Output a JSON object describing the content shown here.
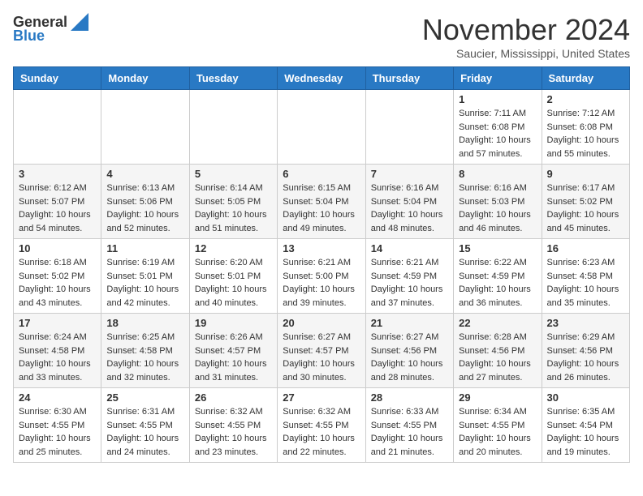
{
  "header": {
    "logo_general": "General",
    "logo_blue": "Blue",
    "month_title": "November 2024",
    "location": "Saucier, Mississippi, United States"
  },
  "weekdays": [
    "Sunday",
    "Monday",
    "Tuesday",
    "Wednesday",
    "Thursday",
    "Friday",
    "Saturday"
  ],
  "weeks": [
    [
      {
        "day": "",
        "info": ""
      },
      {
        "day": "",
        "info": ""
      },
      {
        "day": "",
        "info": ""
      },
      {
        "day": "",
        "info": ""
      },
      {
        "day": "",
        "info": ""
      },
      {
        "day": "1",
        "info": "Sunrise: 7:11 AM\nSunset: 6:08 PM\nDaylight: 10 hours and 57 minutes."
      },
      {
        "day": "2",
        "info": "Sunrise: 7:12 AM\nSunset: 6:08 PM\nDaylight: 10 hours and 55 minutes."
      }
    ],
    [
      {
        "day": "3",
        "info": "Sunrise: 6:12 AM\nSunset: 5:07 PM\nDaylight: 10 hours and 54 minutes."
      },
      {
        "day": "4",
        "info": "Sunrise: 6:13 AM\nSunset: 5:06 PM\nDaylight: 10 hours and 52 minutes."
      },
      {
        "day": "5",
        "info": "Sunrise: 6:14 AM\nSunset: 5:05 PM\nDaylight: 10 hours and 51 minutes."
      },
      {
        "day": "6",
        "info": "Sunrise: 6:15 AM\nSunset: 5:04 PM\nDaylight: 10 hours and 49 minutes."
      },
      {
        "day": "7",
        "info": "Sunrise: 6:16 AM\nSunset: 5:04 PM\nDaylight: 10 hours and 48 minutes."
      },
      {
        "day": "8",
        "info": "Sunrise: 6:16 AM\nSunset: 5:03 PM\nDaylight: 10 hours and 46 minutes."
      },
      {
        "day": "9",
        "info": "Sunrise: 6:17 AM\nSunset: 5:02 PM\nDaylight: 10 hours and 45 minutes."
      }
    ],
    [
      {
        "day": "10",
        "info": "Sunrise: 6:18 AM\nSunset: 5:02 PM\nDaylight: 10 hours and 43 minutes."
      },
      {
        "day": "11",
        "info": "Sunrise: 6:19 AM\nSunset: 5:01 PM\nDaylight: 10 hours and 42 minutes."
      },
      {
        "day": "12",
        "info": "Sunrise: 6:20 AM\nSunset: 5:01 PM\nDaylight: 10 hours and 40 minutes."
      },
      {
        "day": "13",
        "info": "Sunrise: 6:21 AM\nSunset: 5:00 PM\nDaylight: 10 hours and 39 minutes."
      },
      {
        "day": "14",
        "info": "Sunrise: 6:21 AM\nSunset: 4:59 PM\nDaylight: 10 hours and 37 minutes."
      },
      {
        "day": "15",
        "info": "Sunrise: 6:22 AM\nSunset: 4:59 PM\nDaylight: 10 hours and 36 minutes."
      },
      {
        "day": "16",
        "info": "Sunrise: 6:23 AM\nSunset: 4:58 PM\nDaylight: 10 hours and 35 minutes."
      }
    ],
    [
      {
        "day": "17",
        "info": "Sunrise: 6:24 AM\nSunset: 4:58 PM\nDaylight: 10 hours and 33 minutes."
      },
      {
        "day": "18",
        "info": "Sunrise: 6:25 AM\nSunset: 4:58 PM\nDaylight: 10 hours and 32 minutes."
      },
      {
        "day": "19",
        "info": "Sunrise: 6:26 AM\nSunset: 4:57 PM\nDaylight: 10 hours and 31 minutes."
      },
      {
        "day": "20",
        "info": "Sunrise: 6:27 AM\nSunset: 4:57 PM\nDaylight: 10 hours and 30 minutes."
      },
      {
        "day": "21",
        "info": "Sunrise: 6:27 AM\nSunset: 4:56 PM\nDaylight: 10 hours and 28 minutes."
      },
      {
        "day": "22",
        "info": "Sunrise: 6:28 AM\nSunset: 4:56 PM\nDaylight: 10 hours and 27 minutes."
      },
      {
        "day": "23",
        "info": "Sunrise: 6:29 AM\nSunset: 4:56 PM\nDaylight: 10 hours and 26 minutes."
      }
    ],
    [
      {
        "day": "24",
        "info": "Sunrise: 6:30 AM\nSunset: 4:55 PM\nDaylight: 10 hours and 25 minutes."
      },
      {
        "day": "25",
        "info": "Sunrise: 6:31 AM\nSunset: 4:55 PM\nDaylight: 10 hours and 24 minutes."
      },
      {
        "day": "26",
        "info": "Sunrise: 6:32 AM\nSunset: 4:55 PM\nDaylight: 10 hours and 23 minutes."
      },
      {
        "day": "27",
        "info": "Sunrise: 6:32 AM\nSunset: 4:55 PM\nDaylight: 10 hours and 22 minutes."
      },
      {
        "day": "28",
        "info": "Sunrise: 6:33 AM\nSunset: 4:55 PM\nDaylight: 10 hours and 21 minutes."
      },
      {
        "day": "29",
        "info": "Sunrise: 6:34 AM\nSunset: 4:55 PM\nDaylight: 10 hours and 20 minutes."
      },
      {
        "day": "30",
        "info": "Sunrise: 6:35 AM\nSunset: 4:54 PM\nDaylight: 10 hours and 19 minutes."
      }
    ]
  ]
}
